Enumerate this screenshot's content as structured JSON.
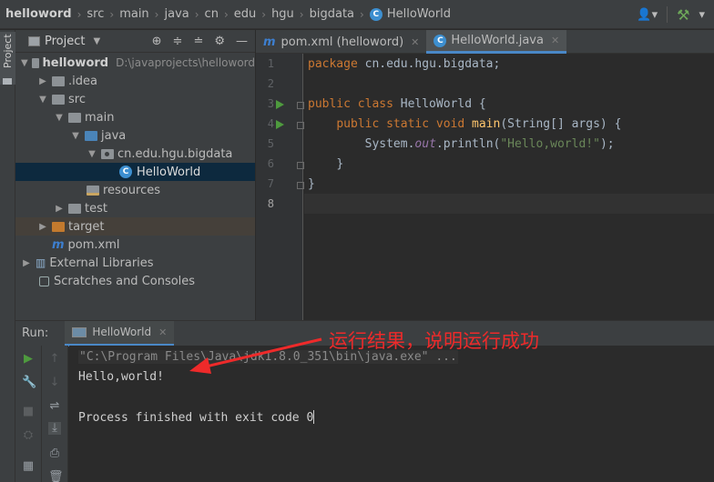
{
  "breadcrumb": [
    "helloword",
    "src",
    "main",
    "java",
    "cn",
    "edu",
    "hgu",
    "bigdata",
    "HelloWorld"
  ],
  "left_strip": {
    "tab": "Project"
  },
  "project_panel": {
    "title": "Project",
    "tree": [
      {
        "label": "helloword",
        "path": "D:\\javaprojects\\helloword"
      },
      {
        "label": ".idea"
      },
      {
        "label": "src"
      },
      {
        "label": "main"
      },
      {
        "label": "java"
      },
      {
        "label": "cn.edu.hgu.bigdata"
      },
      {
        "label": "HelloWorld"
      },
      {
        "label": "resources"
      },
      {
        "label": "test"
      },
      {
        "label": "target"
      },
      {
        "label": "pom.xml"
      },
      {
        "label": "External Libraries"
      },
      {
        "label": "Scratches and Consoles"
      }
    ]
  },
  "editor": {
    "tabs": [
      {
        "label": "pom.xml (helloword)",
        "active": false
      },
      {
        "label": "HelloWorld.java",
        "active": true
      }
    ],
    "line_numbers": [
      "1",
      "2",
      "3",
      "4",
      "5",
      "6",
      "7",
      "8"
    ],
    "code": {
      "l1_kw": "package",
      "l1_rest": " cn.edu.hgu.bigdata;",
      "l3_kw": "public class",
      "l3_rest": " HelloWorld {",
      "l4_kw": "public static void",
      "l4_fn": "main",
      "l4_rest": "(String[] args) {",
      "l5_a": "System.",
      "l5_out": "out",
      "l5_b": ".println(",
      "l5_str": "\"Hello,world!\"",
      "l5_c": ");",
      "l6": "}",
      "l7": "}"
    }
  },
  "run_panel": {
    "label": "Run:",
    "tab": "HelloWorld",
    "command": "\"C:\\Program Files\\Java\\jdk1.8.0_351\\bin\\java.exe\" ...",
    "output": "Hello,world!",
    "exit": "Process finished with exit code 0"
  },
  "annotation": {
    "text": "运行结果，说明运行成功",
    "color": "#ee2a2a"
  },
  "colors": {
    "keyword": "#cc7832",
    "function": "#ffc66d",
    "string": "#6a8759",
    "field": "#9876aa",
    "selection": "#0d293e",
    "accent": "#4a88c7"
  }
}
